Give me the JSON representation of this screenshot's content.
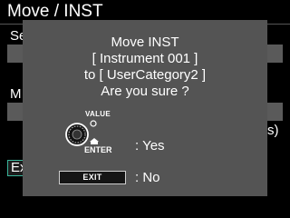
{
  "page": {
    "title": "Move / INST",
    "row1_label": "Se",
    "row2_label": "M",
    "right_text": "s)",
    "exit_button": "Ex"
  },
  "dialog": {
    "line1": "Move INST",
    "line2": "[ Instrument 001 ]",
    "line3": "to [ UserCategory2 ]",
    "line4": "Are you sure ?",
    "knob_label": "VALUE",
    "enter_label": "ENTER",
    "yes_label": ": Yes",
    "exit_button": "EXIT",
    "no_label": ": No"
  },
  "colors": {
    "dialog_bg": "#545454",
    "field_bg": "#5a5a5a",
    "selection_border": "#39b59a"
  }
}
